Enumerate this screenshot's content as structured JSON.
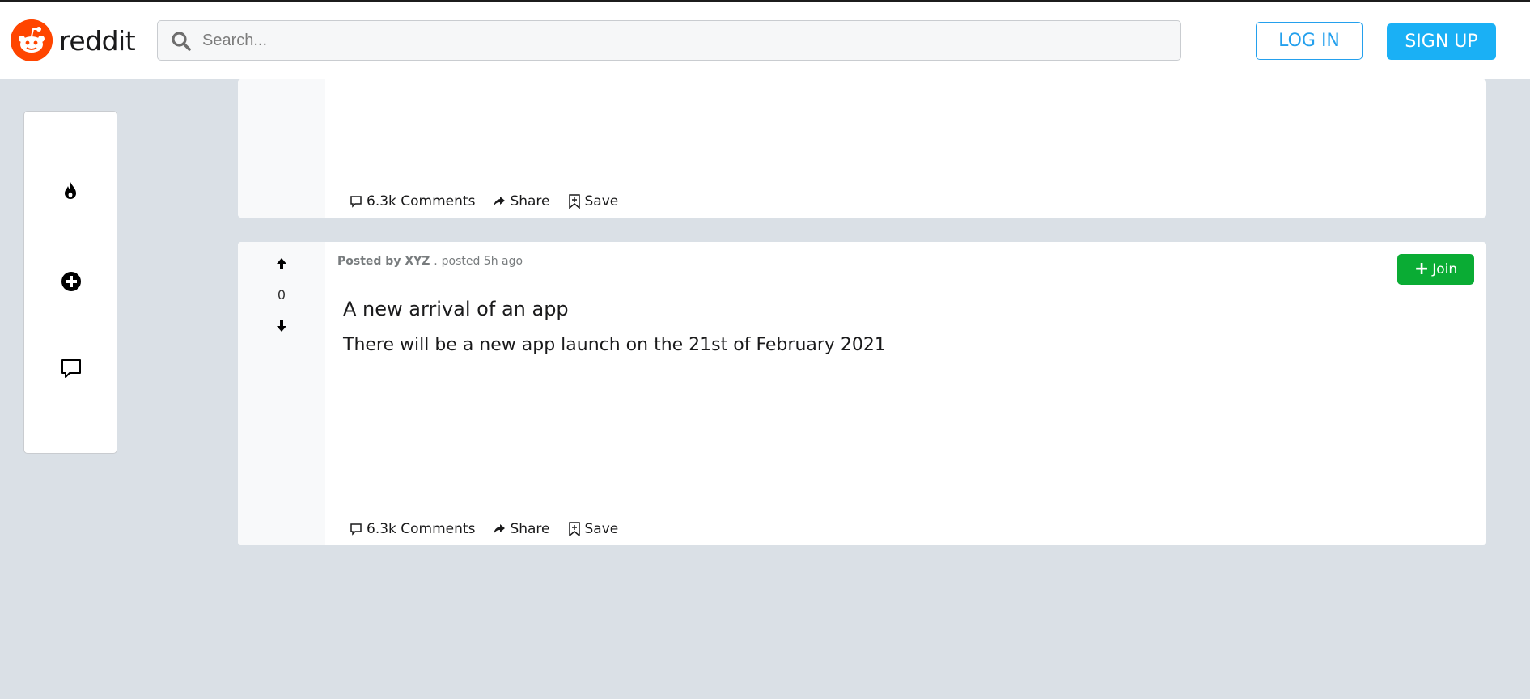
{
  "header": {
    "logo_text": "reddit",
    "search": {
      "placeholder": "Search...",
      "value": ""
    },
    "login_label": "LOG IN",
    "signup_label": "SIGN UP"
  },
  "sidebar": {
    "items": [
      {
        "icon": "flame-icon"
      },
      {
        "icon": "plus-circle-icon"
      },
      {
        "icon": "comment-icon"
      }
    ]
  },
  "posts": [
    {
      "actions": {
        "comments": "6.3k Comments",
        "share": "Share",
        "save": "Save"
      }
    },
    {
      "votes": "0",
      "meta": {
        "prefix": "Posted by",
        "author": "XYZ",
        "separator": ".",
        "time": "posted 5h ago"
      },
      "title": "A new arrival of an app",
      "body": "There will be a new app launch on the 21st of February 2021",
      "join_label": "Join",
      "actions": {
        "comments": "6.3k Comments",
        "share": "Share",
        "save": "Save"
      }
    }
  ],
  "colors": {
    "brand": "#ff4500",
    "accent": "#24a0ed",
    "signup": "#1ab0f5",
    "join": "#0aac34",
    "background": "#dae0e6"
  }
}
